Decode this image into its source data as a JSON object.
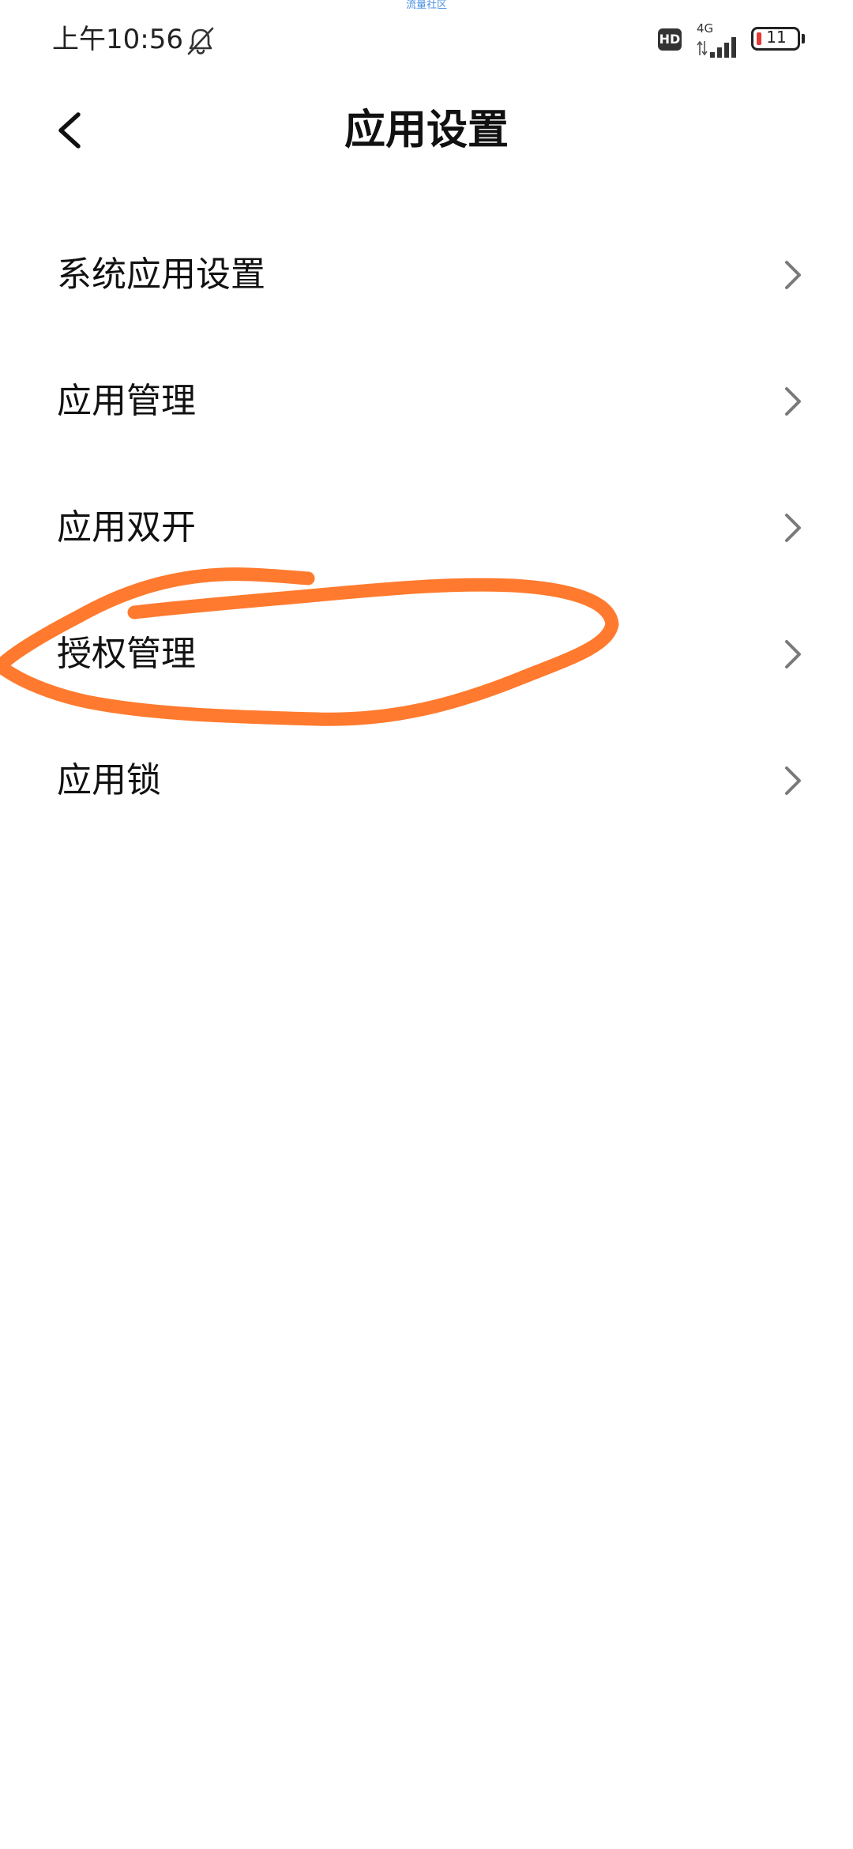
{
  "watermark": {
    "text": "流量社区"
  },
  "status_bar": {
    "time": "上午10:56",
    "mute_icon": "bell-off-icon",
    "hd_badge": "HD",
    "network_type": "4G",
    "battery_level": "11",
    "battery_fill_color": "#e53935"
  },
  "header": {
    "back_icon": "chevron-left-icon",
    "title": "应用设置"
  },
  "settings_list": {
    "chevron_icon": "chevron-right-icon",
    "items": [
      {
        "label": "系统应用设置"
      },
      {
        "label": "应用管理"
      },
      {
        "label": "应用双开"
      },
      {
        "label": "授权管理"
      },
      {
        "label": "应用锁"
      }
    ]
  },
  "annotation": {
    "color": "#ff7a2e",
    "encircled_item": "授权管理"
  }
}
